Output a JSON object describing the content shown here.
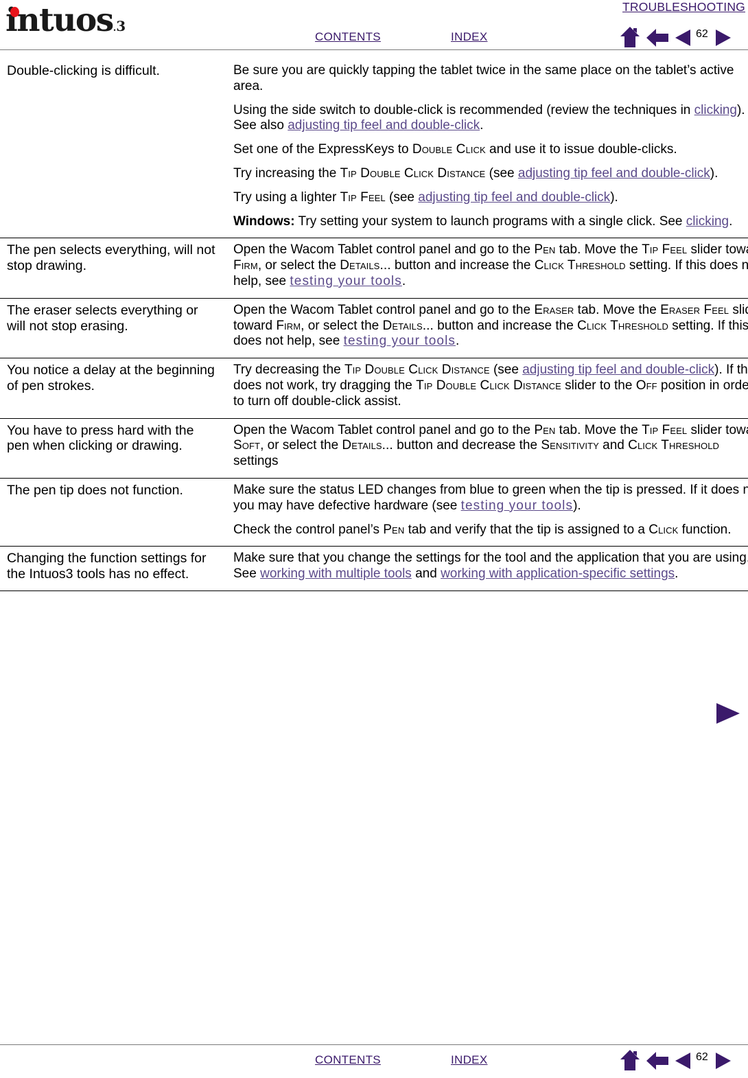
{
  "header": {
    "section_title": "TROUBLESHOOTING",
    "logo_text": "intuos",
    "logo_sub": "3",
    "contents_label": "CONTENTS",
    "index_label": "INDEX",
    "page_number": "62",
    "icons": {
      "home": "home-icon",
      "back": "back-arrow-icon",
      "prev": "previous-page-icon",
      "next": "next-page-icon"
    }
  },
  "footer": {
    "contents_label": "CONTENTS",
    "index_label": "INDEX",
    "page_number": "62"
  },
  "colors": {
    "link": "#5b4a8a",
    "nav_purple": "#3b1a6b",
    "logo_dot_red": "#e8141b",
    "rule": "#7a7a7a"
  },
  "table": {
    "rows": [
      {
        "issue": "Double-clicking is difficult.",
        "paragraphs": [
          {
            "parts": [
              {
                "t": "Be sure you are quickly tapping the tablet twice in the same place on the tablet’s active area.",
                "s": "plain"
              }
            ]
          },
          {
            "parts": [
              {
                "t": "Using the side switch to double-click is recommended (review the techniques in ",
                "s": "plain"
              },
              {
                "t": "clicking",
                "s": "link"
              },
              {
                "t": ").  See also ",
                "s": "plain"
              },
              {
                "t": "adjusting tip feel and double-click",
                "s": "link"
              },
              {
                "t": ".",
                "s": "plain"
              }
            ]
          },
          {
            "parts": [
              {
                "t": "Set one of the ExpressKeys to ",
                "s": "plain"
              },
              {
                "t": "Double Click",
                "s": "smallcaps"
              },
              {
                "t": " and use it to issue double-clicks.",
                "s": "plain"
              }
            ]
          },
          {
            "parts": [
              {
                "t": "Try increasing the ",
                "s": "plain"
              },
              {
                "t": "Tip Double Click Distance",
                "s": "smallcaps"
              },
              {
                "t": " (see ",
                "s": "plain"
              },
              {
                "t": "adjusting tip feel and double-click",
                "s": "link"
              },
              {
                "t": ").",
                "s": "plain"
              }
            ]
          },
          {
            "parts": [
              {
                "t": "Try using a lighter ",
                "s": "plain"
              },
              {
                "t": "Tip Feel",
                "s": "smallcaps"
              },
              {
                "t": " (see ",
                "s": "plain"
              },
              {
                "t": "adjusting tip feel and double-click",
                "s": "link"
              },
              {
                "t": ").",
                "s": "plain"
              }
            ]
          },
          {
            "parts": [
              {
                "t": "Windows:",
                "s": "bold"
              },
              {
                "t": " Try setting your system to launch programs with a single click.  See ",
                "s": "plain"
              },
              {
                "t": "clicking",
                "s": "link"
              },
              {
                "t": ".",
                "s": "plain"
              }
            ]
          }
        ]
      },
      {
        "issue": "The pen selects everything, will not stop drawing.",
        "paragraphs": [
          {
            "parts": [
              {
                "t": "Open the Wacom Tablet control panel and go to the ",
                "s": "plain"
              },
              {
                "t": "Pen",
                "s": "smallcaps"
              },
              {
                "t": " tab.  Move the ",
                "s": "plain"
              },
              {
                "t": "Tip Feel",
                "s": "smallcaps"
              },
              {
                "t": " slider toward ",
                "s": "plain"
              },
              {
                "t": "Firm",
                "s": "smallcaps"
              },
              {
                "t": ", or select the ",
                "s": "plain"
              },
              {
                "t": "Details...",
                "s": "smallcaps"
              },
              {
                "t": " button and increase the ",
                "s": "plain"
              },
              {
                "t": "Click Threshold",
                "s": "smallcaps"
              },
              {
                "t": " setting.  If this does not help, see ",
                "s": "plain"
              },
              {
                "t": "testing your tools",
                "s": "link-wide"
              },
              {
                "t": ".",
                "s": "plain"
              }
            ]
          }
        ]
      },
      {
        "issue": "The eraser selects everything or will not stop erasing.",
        "paragraphs": [
          {
            "parts": [
              {
                "t": "Open the Wacom Tablet control panel and go to the ",
                "s": "plain"
              },
              {
                "t": "Eraser",
                "s": "smallcaps"
              },
              {
                "t": " tab.  Move the ",
                "s": "plain"
              },
              {
                "t": "Eraser Feel",
                "s": "smallcaps"
              },
              {
                "t": " slider toward ",
                "s": "plain"
              },
              {
                "t": "Firm",
                "s": "smallcaps"
              },
              {
                "t": ", or select the ",
                "s": "plain"
              },
              {
                "t": "Details...",
                "s": "smallcaps"
              },
              {
                "t": " button and increase the ",
                "s": "plain"
              },
              {
                "t": "Click Threshold",
                "s": "smallcaps"
              },
              {
                "t": " setting.  If this does not help, see ",
                "s": "plain"
              },
              {
                "t": "testing your tools",
                "s": "link-wide"
              },
              {
                "t": ".",
                "s": "plain"
              }
            ]
          }
        ]
      },
      {
        "issue": "You notice a delay at the beginning of pen strokes.",
        "paragraphs": [
          {
            "parts": [
              {
                "t": "Try decreasing the ",
                "s": "plain"
              },
              {
                "t": "Tip Double Click Distance",
                "s": "smallcaps"
              },
              {
                "t": " (see ",
                "s": "plain"
              },
              {
                "t": "adjusting tip feel and double-click",
                "s": "link"
              },
              {
                "t": ").  If that does not work, try dragging the ",
                "s": "plain"
              },
              {
                "t": "Tip Double Click Distance",
                "s": "smallcaps"
              },
              {
                "t": " slider to the ",
                "s": "plain"
              },
              {
                "t": "Off",
                "s": "smallcaps"
              },
              {
                "t": " position in order to turn off double-click assist.",
                "s": "plain"
              }
            ]
          }
        ]
      },
      {
        "issue": "You have to press hard with the pen when clicking or drawing.",
        "paragraphs": [
          {
            "parts": [
              {
                "t": "Open the Wacom Tablet control panel and go to the ",
                "s": "plain"
              },
              {
                "t": "Pen",
                "s": "smallcaps"
              },
              {
                "t": " tab.  Move the ",
                "s": "plain"
              },
              {
                "t": "Tip Feel",
                "s": "smallcaps"
              },
              {
                "t": " slider toward ",
                "s": "plain"
              },
              {
                "t": "Soft",
                "s": "smallcaps"
              },
              {
                "t": ", or select the ",
                "s": "plain"
              },
              {
                "t": "Details...",
                "s": "smallcaps"
              },
              {
                "t": " button and decrease the ",
                "s": "plain"
              },
              {
                "t": "Sensitivity",
                "s": "smallcaps"
              },
              {
                "t": " and ",
                "s": "plain"
              },
              {
                "t": "Click Threshold",
                "s": "smallcaps"
              },
              {
                "t": " settings",
                "s": "plain"
              }
            ]
          }
        ]
      },
      {
        "issue": "The pen tip does not function.",
        "paragraphs": [
          {
            "parts": [
              {
                "t": "Make sure the status LED changes from blue to green when the tip is pressed.  If it does not, you may have defective hardware (see ",
                "s": "plain"
              },
              {
                "t": "testing your tools",
                "s": "link-wide"
              },
              {
                "t": ").",
                "s": "plain"
              }
            ]
          },
          {
            "parts": [
              {
                "t": "Check the control panel’s ",
                "s": "plain"
              },
              {
                "t": "Pen",
                "s": "smallcaps"
              },
              {
                "t": " tab and verify that the tip is assigned to a ",
                "s": "plain"
              },
              {
                "t": "Click",
                "s": "smallcaps"
              },
              {
                "t": " function.",
                "s": "plain"
              }
            ]
          }
        ]
      },
      {
        "issue": "Changing the function settings for the Intuos3 tools has no effect.",
        "paragraphs": [
          {
            "parts": [
              {
                "t": "Make sure that you change the settings for the tool and the application that you are using.  See ",
                "s": "plain"
              },
              {
                "t": "working with multiple tools",
                "s": "link"
              },
              {
                "t": " and ",
                "s": "plain"
              },
              {
                "t": "working with application-specific settings",
                "s": "link"
              },
              {
                "t": ".",
                "s": "plain"
              }
            ]
          }
        ]
      }
    ]
  }
}
